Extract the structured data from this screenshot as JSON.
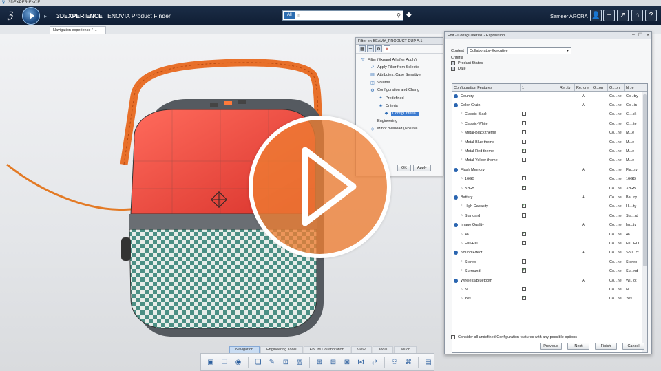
{
  "os_title": "3DEXPERIENCE",
  "header": {
    "app_title_brand": "3DEXPERIENCE",
    "app_title_rest": " | ENOVIA Product Finder",
    "search_scope": "All",
    "search_placeholder": "In",
    "user_name": "Sameer ARORA",
    "icons": [
      "user-icon",
      "plus-icon",
      "share-icon",
      "home-icon",
      "help-icon"
    ]
  },
  "tab": {
    "label": "Navigation experience / ..."
  },
  "filter_panel": {
    "title": "Filter on BEAMY_PRODUCT-DUP A.1",
    "tree": [
      {
        "label": "Filter (Expand All after Apply)",
        "icon": "filter-icon"
      },
      {
        "label": "Apply Filter from Selectio",
        "icon": "cursor-icon"
      },
      {
        "label": "Attributes, Case Sensitive",
        "icon": "attributes-icon"
      },
      {
        "label": "Volume...",
        "icon": "volume-icon"
      },
      {
        "label": "Configuration and Chang",
        "icon": "configuration-icon"
      },
      {
        "label": "Predefined",
        "icon": "predefined-icon"
      },
      {
        "label": "Criteria",
        "icon": "criteria-icon"
      },
      {
        "label": "ConfigCriteria1",
        "icon": "criteria-item-icon",
        "selected": true
      },
      {
        "label": "Engineering",
        "icon": "engineering-icon"
      },
      {
        "label": "Minor overload (No Ove",
        "icon": "minor-icon"
      }
    ],
    "ok_label": "OK",
    "apply_label": "Apply"
  },
  "expr_dialog": {
    "title": "Edit - ConfigCriteria1 - Expression",
    "context_label": "Context",
    "context_value": "Collaborator-Executive",
    "criteria_label": "Criteria",
    "criteria_items": [
      "Product States",
      "Date"
    ],
    "columns": [
      "Configuration Features",
      "1",
      "Re..ity",
      "Re..ore",
      "O...on",
      "O...on",
      "N...e"
    ],
    "rows": [
      {
        "name": "Country",
        "level": 0,
        "c2": "A",
        "c3": "Co...ne",
        "c4": "Co...try"
      },
      {
        "name": "Color-Grain",
        "level": 0,
        "c2": "A",
        "c3": "Co...ne",
        "c4": "Co...in"
      },
      {
        "name": "Classic-Black",
        "level": 1,
        "check": false,
        "c3": "Co...ne",
        "c4": "Cl...ck"
      },
      {
        "name": "Classic-White",
        "level": 1,
        "check": false,
        "c3": "Co...ne",
        "c4": "Cl...ite"
      },
      {
        "name": "Metal-Black theme",
        "level": 1,
        "check": false,
        "c3": "Co...ne",
        "c4": "M...e"
      },
      {
        "name": "Metal-Blue theme",
        "level": 1,
        "check": false,
        "c3": "Co...ne",
        "c4": "M...e"
      },
      {
        "name": "Metal-Red theme",
        "level": 1,
        "check": true,
        "c3": "Co...ne",
        "c4": "M...e"
      },
      {
        "name": "Metal-Yellow theme",
        "level": 1,
        "check": false,
        "c3": "Co...ne",
        "c4": "M...e"
      },
      {
        "name": "Flash Memory",
        "level": 0,
        "c2": "A",
        "c3": "Co...ne",
        "c4": "Fla...ry"
      },
      {
        "name": "16GB",
        "level": 1,
        "check": false,
        "c3": "Co...ne",
        "c4": "16GB"
      },
      {
        "name": "32GB",
        "level": 1,
        "check": true,
        "c3": "Co...ne",
        "c4": "32GB"
      },
      {
        "name": "Battery",
        "level": 0,
        "c2": "A",
        "c3": "Co...ne",
        "c4": "Ba...ry"
      },
      {
        "name": "High Capacity",
        "level": 1,
        "check": true,
        "c3": "Co...ne",
        "c4": "Hi...ity"
      },
      {
        "name": "Standard",
        "level": 1,
        "check": false,
        "c3": "Co...ne",
        "c4": "Sta...rd"
      },
      {
        "name": "Image Quality",
        "level": 0,
        "c2": "A",
        "c3": "Co...ne",
        "c4": "Im...ty"
      },
      {
        "name": "4K",
        "level": 1,
        "check": true,
        "c3": "Co...ne",
        "c4": "4K"
      },
      {
        "name": "Full-HD",
        "level": 1,
        "check": false,
        "c3": "Co...ne",
        "c4": "Fu...HD"
      },
      {
        "name": "Sound Effect",
        "level": 0,
        "c2": "A",
        "c3": "Co...ne",
        "c4": "Sou...ct"
      },
      {
        "name": "Stereo",
        "level": 1,
        "check": false,
        "c3": "Co...ne",
        "c4": "Stereo"
      },
      {
        "name": "Surround",
        "level": 1,
        "check": true,
        "c3": "Co...ne",
        "c4": "Su...nd"
      },
      {
        "name": "Wireless/Bluetooth",
        "level": 0,
        "c2": "A",
        "c3": "Co...ne",
        "c4": "Wi...ot"
      },
      {
        "name": "NO",
        "level": 1,
        "check": false,
        "c3": "Co...ne",
        "c4": "NO"
      },
      {
        "name": "Yes",
        "level": 1,
        "check": true,
        "c3": "Co...ne",
        "c4": "Yes"
      }
    ],
    "consider_label": "Consider all undefined Configuration features with any possible options",
    "buttons": [
      "Previous",
      "Next",
      "Finish",
      "Cancel"
    ]
  },
  "action_tabs": [
    "Navigation",
    "Engineering Tools",
    "EBOM Collaboration",
    "View",
    "Tools",
    "Touch"
  ],
  "action_icons": [
    "boxes-icon",
    "layers-icon",
    "sphere-icon",
    "open-folder-icon",
    "folder-edit-icon",
    "folder-lock-icon",
    "image-icon",
    "tree-expand-icon",
    "tree-filter-icon",
    "tree-collapse-icon",
    "tree-merge-icon",
    "tree-compare-icon",
    "user-group-icon",
    "network-icon",
    "document-icon"
  ],
  "colors": {
    "header_bg": "#13233d",
    "play_orange": "#ee7d32",
    "product_red": "#f0483e",
    "handle_orange": "#e8702a",
    "grille_teal": "#3f9187"
  }
}
